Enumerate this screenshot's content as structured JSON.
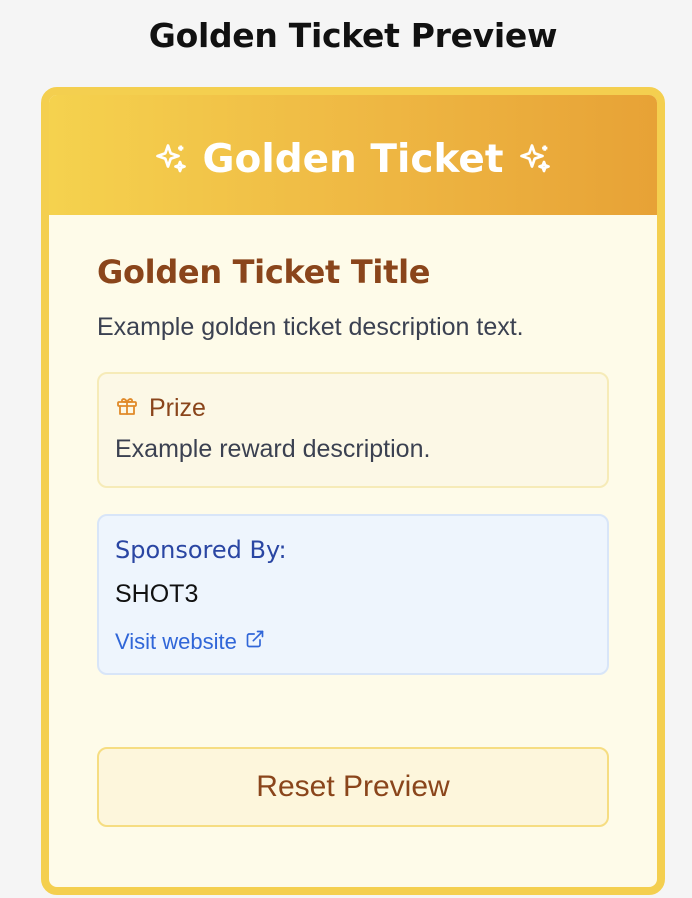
{
  "page": {
    "title": "Golden Ticket Preview"
  },
  "ticket": {
    "header_title": "Golden Ticket",
    "header_icon": "sparkles-icon",
    "title": "Golden Ticket Title",
    "description": "Example golden ticket description text.",
    "prize": {
      "icon": "gift-icon",
      "label": "Prize",
      "description": "Example reward description."
    },
    "sponsor": {
      "label": "Sponsored By:",
      "name": "SHOT3",
      "link_label": "Visit website",
      "link_icon": "external-link-icon"
    },
    "reset_label": "Reset Preview"
  },
  "colors": {
    "gold_border": "#f4cf4f",
    "header_gradient_start": "#f5d24e",
    "header_gradient_end": "#e7a236",
    "brown_text": "#8a451b",
    "sponsor_blue": "#2a46a3",
    "link_blue": "#3066d8"
  }
}
